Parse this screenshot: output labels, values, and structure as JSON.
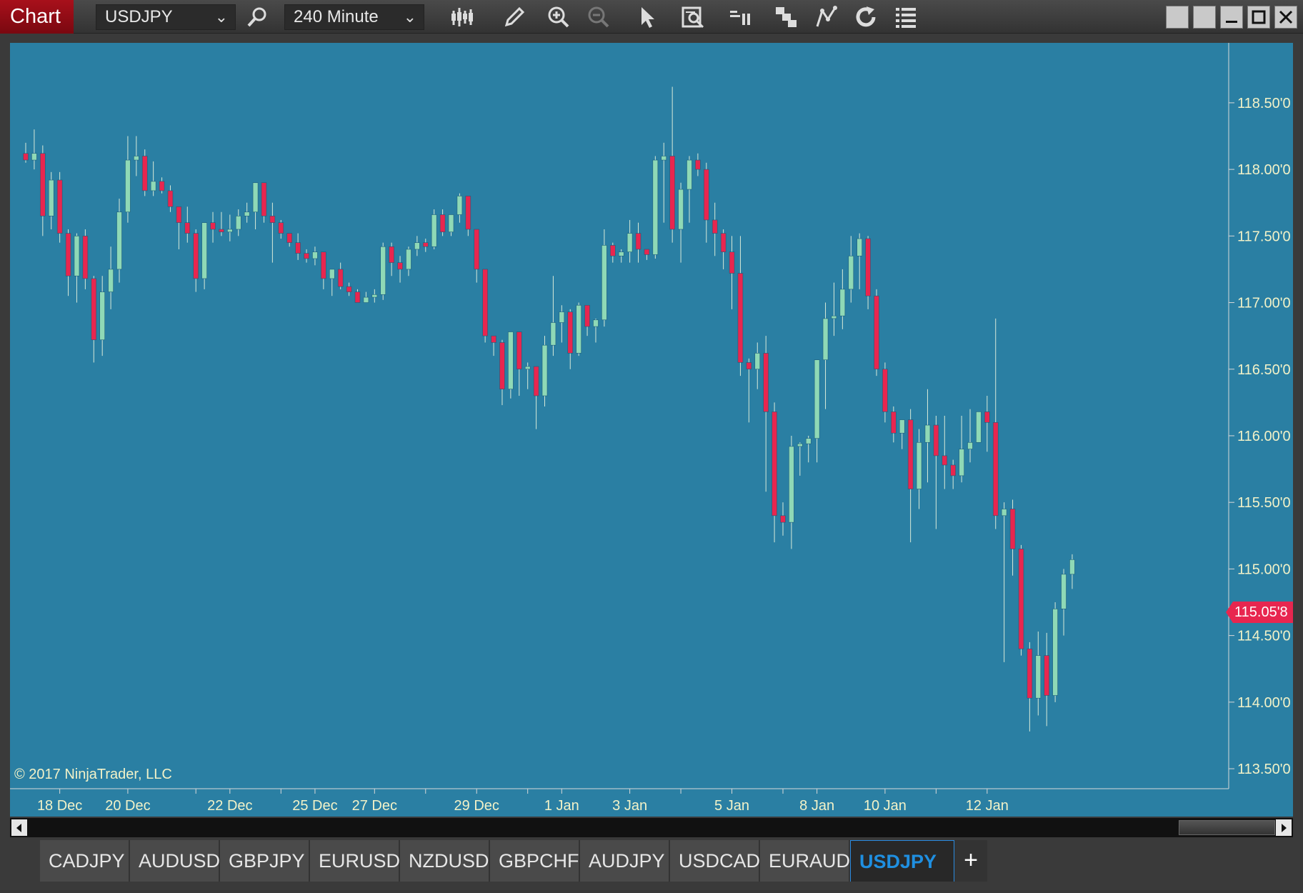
{
  "window": {
    "title": "Chart",
    "instrument": "USDJPY",
    "interval": "240 Minute",
    "toolbar_icons": [
      "search-icon",
      "bar-style-icon",
      "drawing-pencil-icon",
      "zoom-in-icon",
      "zoom-out-icon",
      "pointer-icon",
      "data-box-icon",
      "chart-trader-icon",
      "strategy-icon",
      "indicators-icon",
      "reload-icon",
      "properties-icon"
    ],
    "window_controls": [
      "tile-left-icon",
      "tile-right-icon",
      "minimize-icon",
      "maximize-icon",
      "close-icon"
    ]
  },
  "copyright": "© 2017 NinjaTrader, LLC",
  "last_price": "115.05'8",
  "tabs": [
    "CADJPY",
    "AUDUSD",
    "GBPJPY",
    "EURUSD",
    "NZDUSD",
    "GBPCHF",
    "AUDJPY",
    "USDCAD",
    "EURAUD",
    "USDJPY"
  ],
  "active_tab": "USDJPY",
  "colors": {
    "background": "#2a7fa3",
    "up": "#8fd9b6",
    "down": "#e8264f",
    "text": "#f2f2c8"
  },
  "chart_data": {
    "type": "candlestick",
    "instrument": "USDJPY",
    "ylim": [
      113.35,
      118.95
    ],
    "y_ticks": [
      {
        "value": 118.5,
        "label": "118.50'0"
      },
      {
        "value": 118.0,
        "label": "118.00'0"
      },
      {
        "value": 117.5,
        "label": "117.50'0"
      },
      {
        "value": 117.0,
        "label": "117.00'0"
      },
      {
        "value": 116.5,
        "label": "116.50'0"
      },
      {
        "value": 116.0,
        "label": "116.00'0"
      },
      {
        "value": 115.5,
        "label": "115.50'0"
      },
      {
        "value": 115.0,
        "label": "115.00'0"
      },
      {
        "value": 114.5,
        "label": "114.50'0"
      },
      {
        "value": 114.0,
        "label": "114.00'0"
      },
      {
        "value": 113.5,
        "label": "113.50'0"
      }
    ],
    "x_labels": [
      {
        "bar": 4,
        "label": "18 Dec"
      },
      {
        "bar": 12,
        "label": "20 Dec"
      },
      {
        "bar": 24,
        "label": "22 Dec"
      },
      {
        "bar": 34,
        "label": "25 Dec"
      },
      {
        "bar": 41,
        "label": "27 Dec"
      },
      {
        "bar": 53,
        "label": "29 Dec"
      },
      {
        "bar": 63,
        "label": "1 Jan"
      },
      {
        "bar": 71,
        "label": "3 Jan"
      },
      {
        "bar": 83,
        "label": "5 Jan"
      },
      {
        "bar": 93,
        "label": "8 Jan"
      },
      {
        "bar": 101,
        "label": "10 Jan"
      },
      {
        "bar": 113,
        "label": "12 Jan"
      }
    ],
    "x_ticks": [
      4,
      12,
      20,
      24,
      30,
      34,
      41,
      47,
      53,
      59,
      63,
      71,
      77,
      83,
      89,
      93,
      101,
      107,
      113
    ],
    "ohlc": [
      [
        118.12,
        118.2,
        118.05,
        118.07
      ],
      [
        118.07,
        118.3,
        118.0,
        118.12
      ],
      [
        118.12,
        118.18,
        117.5,
        117.65
      ],
      [
        117.65,
        117.98,
        117.55,
        117.92
      ],
      [
        117.92,
        117.98,
        117.45,
        117.52
      ],
      [
        117.52,
        117.55,
        117.05,
        117.2
      ],
      [
        117.2,
        117.52,
        117.0,
        117.5
      ],
      [
        117.5,
        117.55,
        117.1,
        117.18
      ],
      [
        117.18,
        117.2,
        116.55,
        116.72
      ],
      [
        116.72,
        117.2,
        116.6,
        117.08
      ],
      [
        117.08,
        117.42,
        116.95,
        117.25
      ],
      [
        117.25,
        117.78,
        117.15,
        117.68
      ],
      [
        117.68,
        118.25,
        117.6,
        118.07
      ],
      [
        118.07,
        118.25,
        117.95,
        118.1
      ],
      [
        118.1,
        118.15,
        117.8,
        117.84
      ],
      [
        117.84,
        118.06,
        117.8,
        117.91
      ],
      [
        117.91,
        117.94,
        117.82,
        117.84
      ],
      [
        117.84,
        117.88,
        117.68,
        117.72
      ],
      [
        117.72,
        117.72,
        117.4,
        117.6
      ],
      [
        117.6,
        117.72,
        117.45,
        117.52
      ],
      [
        117.52,
        117.55,
        117.08,
        117.18
      ],
      [
        117.18,
        117.6,
        117.1,
        117.6
      ],
      [
        117.6,
        117.68,
        117.45,
        117.55
      ],
      [
        117.55,
        117.68,
        117.5,
        117.53
      ],
      [
        117.53,
        117.66,
        117.46,
        117.55
      ],
      [
        117.55,
        117.7,
        117.5,
        117.65
      ],
      [
        117.65,
        117.75,
        117.6,
        117.68
      ],
      [
        117.68,
        117.9,
        117.55,
        117.9
      ],
      [
        117.9,
        117.9,
        117.6,
        117.65
      ],
      [
        117.65,
        117.75,
        117.3,
        117.6
      ],
      [
        117.6,
        117.62,
        117.48,
        117.52
      ],
      [
        117.52,
        117.52,
        117.42,
        117.45
      ],
      [
        117.45,
        117.52,
        117.32,
        117.37
      ],
      [
        117.37,
        117.4,
        117.3,
        117.33
      ],
      [
        117.33,
        117.42,
        117.28,
        117.38
      ],
      [
        117.38,
        117.38,
        117.1,
        117.18
      ],
      [
        117.18,
        117.25,
        117.05,
        117.25
      ],
      [
        117.25,
        117.3,
        117.1,
        117.12
      ],
      [
        117.12,
        117.15,
        117.05,
        117.08
      ],
      [
        117.08,
        117.1,
        117.0,
        117.0
      ],
      [
        117.0,
        117.08,
        117.0,
        117.04
      ],
      [
        117.04,
        117.1,
        117.0,
        117.06
      ],
      [
        117.06,
        117.45,
        117.02,
        117.42
      ],
      [
        117.42,
        117.45,
        117.2,
        117.3
      ],
      [
        117.3,
        117.35,
        117.15,
        117.25
      ],
      [
        117.25,
        117.42,
        117.2,
        117.4
      ],
      [
        117.4,
        117.5,
        117.35,
        117.45
      ],
      [
        117.45,
        117.48,
        117.38,
        117.42
      ],
      [
        117.42,
        117.7,
        117.4,
        117.66
      ],
      [
        117.66,
        117.7,
        117.5,
        117.53
      ],
      [
        117.53,
        117.66,
        117.5,
        117.66
      ],
      [
        117.66,
        117.82,
        117.6,
        117.8
      ],
      [
        117.8,
        117.8,
        117.5,
        117.55
      ],
      [
        117.55,
        117.55,
        117.15,
        117.25
      ],
      [
        117.25,
        117.25,
        116.7,
        116.75
      ],
      [
        116.75,
        116.75,
        116.6,
        116.7
      ],
      [
        116.7,
        116.72,
        116.23,
        116.35
      ],
      [
        116.35,
        116.78,
        116.28,
        116.78
      ],
      [
        116.78,
        116.78,
        116.3,
        116.5
      ],
      [
        116.5,
        116.55,
        116.35,
        116.52
      ],
      [
        116.52,
        116.52,
        116.05,
        116.3
      ],
      [
        116.3,
        116.75,
        116.22,
        116.68
      ],
      [
        116.68,
        117.2,
        116.6,
        116.85
      ],
      [
        116.85,
        116.98,
        116.7,
        116.93
      ],
      [
        116.93,
        116.95,
        116.5,
        116.62
      ],
      [
        116.62,
        117.0,
        116.6,
        116.98
      ],
      [
        116.98,
        116.98,
        116.75,
        116.82
      ],
      [
        116.82,
        116.88,
        116.7,
        116.87
      ],
      [
        116.87,
        117.55,
        116.82,
        117.43
      ],
      [
        117.43,
        117.45,
        117.3,
        117.35
      ],
      [
        117.35,
        117.4,
        117.3,
        117.38
      ],
      [
        117.38,
        117.62,
        117.3,
        117.52
      ],
      [
        117.52,
        117.6,
        117.3,
        117.4
      ],
      [
        117.4,
        117.4,
        117.32,
        117.36
      ],
      [
        117.36,
        118.1,
        117.33,
        118.07
      ],
      [
        118.07,
        118.2,
        117.6,
        118.1
      ],
      [
        118.1,
        118.62,
        117.45,
        117.55
      ],
      [
        117.55,
        117.9,
        117.3,
        117.85
      ],
      [
        117.85,
        118.1,
        117.6,
        118.07
      ],
      [
        118.07,
        118.12,
        117.95,
        118.0
      ],
      [
        118.0,
        118.05,
        117.45,
        117.62
      ],
      [
        117.62,
        117.75,
        117.35,
        117.52
      ],
      [
        117.52,
        117.55,
        117.25,
        117.38
      ],
      [
        117.38,
        117.5,
        116.95,
        117.22
      ],
      [
        117.22,
        117.5,
        116.45,
        116.55
      ],
      [
        116.55,
        116.58,
        116.1,
        116.5
      ],
      [
        116.5,
        116.7,
        116.35,
        116.62
      ],
      [
        116.62,
        116.75,
        115.58,
        116.18
      ],
      [
        116.18,
        116.25,
        115.2,
        115.4
      ],
      [
        115.4,
        115.5,
        115.25,
        115.35
      ],
      [
        115.35,
        116.0,
        115.15,
        115.92
      ],
      [
        115.92,
        115.95,
        115.7,
        115.94
      ],
      [
        115.94,
        116.0,
        115.8,
        115.98
      ],
      [
        115.98,
        116.4,
        115.8,
        116.57
      ],
      [
        116.57,
        117.0,
        116.2,
        116.88
      ],
      [
        116.88,
        117.15,
        116.75,
        116.9
      ],
      [
        116.9,
        117.25,
        116.8,
        117.1
      ],
      [
        117.1,
        117.5,
        117.0,
        117.35
      ],
      [
        117.35,
        117.52,
        117.1,
        117.48
      ],
      [
        117.48,
        117.5,
        116.95,
        117.05
      ],
      [
        117.05,
        117.1,
        116.45,
        116.5
      ],
      [
        116.5,
        116.55,
        116.1,
        116.18
      ],
      [
        116.18,
        116.22,
        115.95,
        116.02
      ],
      [
        116.02,
        116.12,
        115.9,
        116.12
      ],
      [
        116.12,
        116.2,
        115.2,
        115.6
      ],
      [
        115.6,
        116.05,
        115.45,
        115.95
      ],
      [
        115.95,
        116.35,
        115.65,
        116.08
      ],
      [
        116.08,
        116.15,
        115.3,
        115.85
      ],
      [
        115.85,
        116.15,
        115.6,
        115.78
      ],
      [
        115.78,
        115.82,
        115.6,
        115.7
      ],
      [
        115.7,
        116.15,
        115.65,
        115.9
      ],
      [
        115.9,
        116.2,
        115.8,
        115.95
      ],
      [
        115.95,
        116.15,
        115.95,
        116.18
      ],
      [
        116.18,
        116.3,
        115.88,
        116.1
      ],
      [
        116.1,
        116.88,
        115.3,
        115.4
      ],
      [
        115.4,
        115.5,
        114.3,
        115.45
      ],
      [
        115.45,
        115.52,
        114.95,
        115.15
      ],
      [
        115.15,
        115.18,
        114.35,
        114.4
      ],
      [
        114.4,
        114.45,
        113.78,
        114.03
      ],
      [
        114.03,
        114.53,
        113.9,
        114.35
      ],
      [
        114.35,
        114.52,
        113.82,
        114.05
      ],
      [
        114.05,
        114.75,
        114.0,
        114.7
      ],
      [
        114.7,
        115.0,
        114.5,
        114.96
      ],
      [
        114.96,
        115.11,
        114.85,
        115.07
      ]
    ]
  }
}
